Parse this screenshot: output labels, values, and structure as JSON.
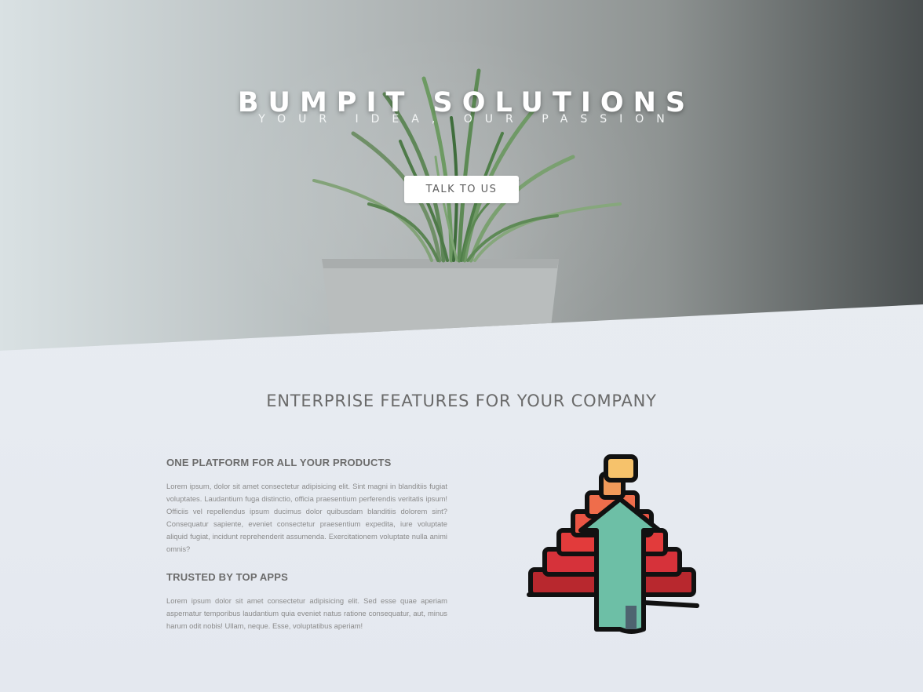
{
  "hero": {
    "title": "BUMPIT SOLUTIONS",
    "subtitle": "YOUR IDEA, OUR PASSION",
    "cta_label": "TALK TO US"
  },
  "features": {
    "section_title": "ENTERPRISE FEATURES FOR YOUR COMPANY",
    "items": [
      {
        "heading": "ONE PLATFORM FOR ALL YOUR PRODUCTS",
        "body": "Lorem ipsum, dolor sit amet consectetur adipisicing elit. Sint magni in blanditiis fugiat voluptates. Laudantium fuga distinctio, officia praesentium perferendis veritatis ipsum! Officiis vel repellendus ipsum ducimus dolor quibusdam blanditiis dolorem sint? Consequatur sapiente, eveniet consectetur praesentium expedita, iure voluptate aliquid fugiat, incidunt reprehenderit assumenda. Exercitationem voluptate nulla animi omnis?"
      },
      {
        "heading": "TRUSTED BY TOP APPS",
        "body": "Lorem ipsum dolor sit amet consectetur adipisicing elit. Sed esse quae aperiam aspernatur temporibus laudantium quia eveniet natus ratione consequatur, aut, minus harum odit nobis! Ullam, neque. Esse, voluptatibus aperiam!"
      }
    ],
    "illustration_icon": "growth-pyramid-arrow-icon"
  },
  "colors": {
    "pyramid_top": "#f6c26b",
    "pyramid_mid": "#ef6d4b",
    "pyramid_low": "#e23b3b",
    "pyramid_base": "#b8282e",
    "arrow": "#6dbfa6",
    "arrow_shadow": "#4e6470",
    "outline": "#111111"
  }
}
